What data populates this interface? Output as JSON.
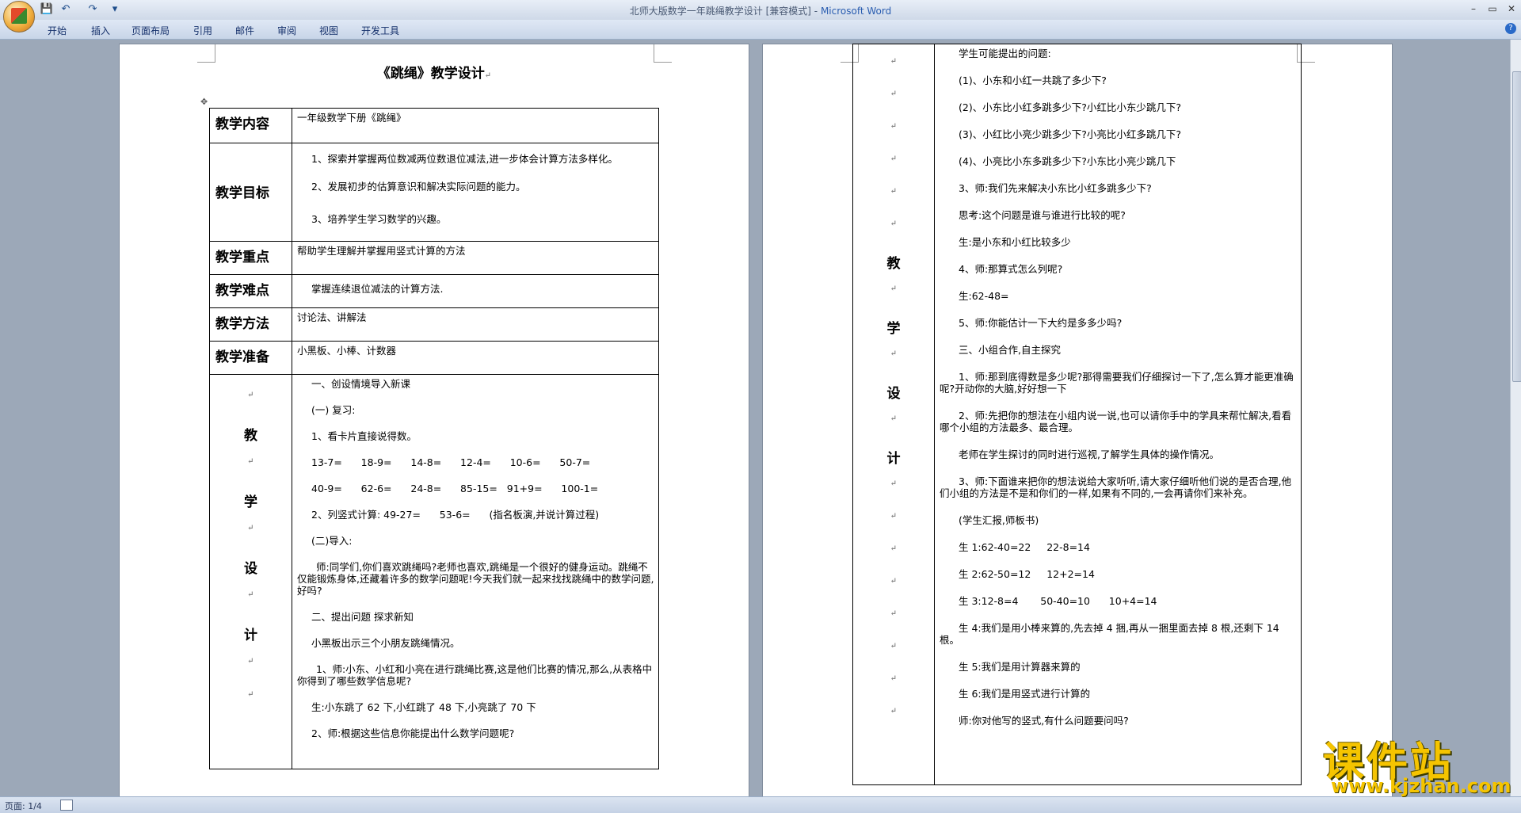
{
  "window": {
    "doc_title": "北师大版数学一年跳绳教学设计 [兼容模式]",
    "separator": " - ",
    "app_name": "Microsoft Word",
    "minimize": "–",
    "maximize": "▭",
    "close": "✕"
  },
  "quick_access": {
    "save": "💾",
    "undo": "↶",
    "redo": "↷",
    "customize": "▾"
  },
  "ribbon": {
    "tabs": [
      "开始",
      "插入",
      "页面布局",
      "引用",
      "邮件",
      "审阅",
      "视图",
      "开发工具"
    ],
    "help": "?"
  },
  "page1": {
    "title": "《跳绳》教学设计",
    "rows": [
      {
        "label": "教学内容",
        "content": [
          "一年级数学下册《跳绳》"
        ]
      },
      {
        "label": "教学目标",
        "content": [
          "1、探索并掌握两位数减两位数退位减法,进一步体会计算方法多样化。",
          "2、发展初步的估算意识和解决实际问题的能力。",
          "3、培养学生学习数学的兴趣。"
        ]
      },
      {
        "label": "教学重点",
        "content": [
          "帮助学生理解并掌握用竖式计算的方法"
        ]
      },
      {
        "label": "教学难点",
        "content": [
          "掌握连续退位减法的计算方法."
        ]
      },
      {
        "label": "教学方法",
        "content": [
          "讨论法、讲解法"
        ]
      },
      {
        "label": "教学准备",
        "content": [
          "小黑板、小棒、计数器"
        ]
      }
    ],
    "design_label": [
      "教",
      "学",
      "设",
      "计"
    ],
    "design_lines": [
      "一、创设情境导入新课",
      "(一) 复习:",
      "1、看卡片直接说得数。",
      "13-7=      18-9=      14-8=      12-4=      10-6=      50-7=",
      "40-9=      62-6=      24-8=      85-15=   91+9=      100-1=",
      "2、列竖式计算: 49-27=      53-6=      (指名板演,并说计算过程)",
      "(二)导入:",
      "师:同学们,你们喜欢跳绳吗?老师也喜欢,跳绳是一个很好的健身运动。跳绳不仅能锻炼身体,还藏着许多的数学问题呢!今天我们就一起来找找跳绳中的数学问题,好吗?",
      "二、提出问题   探求新知",
      "小黑板出示三个小朋友跳绳情况。",
      "1、师:小东、小红和小亮在进行跳绳比赛,这是他们比赛的情况,那么,从表格中你得到了哪些数学信息呢?",
      "生:小东跳了 62 下,小红跳了 48 下,小亮跳了 70 下",
      "2、师:根据这些信息你能提出什么数学问题呢?"
    ]
  },
  "page2": {
    "design_label": [
      "教",
      "学",
      "设",
      "计"
    ],
    "lines": [
      "学生可能提出的问题:",
      "(1)、小东和小红一共跳了多少下?",
      "(2)、小东比小红多跳多少下?小红比小东少跳几下?",
      "(3)、小红比小亮少跳多少下?小亮比小红多跳几下?",
      "(4)、小亮比小东多跳多少下?小东比小亮少跳几下",
      "3、师:我们先来解决小东比小红多跳多少下?",
      "思考:这个问题是谁与谁进行比较的呢?",
      "生:是小东和小红比较多少",
      "4、师:那算式怎么列呢?",
      "生:62-48=",
      "5、师:你能估计一下大约是多多少吗?",
      "三、小组合作,自主探究",
      "1、师:那到底得数是多少呢?那得需要我们仔细探讨一下了,怎么算才能更准确呢?开动你的大脑,好好想一下",
      "2、师:先把你的想法在小组内说一说,也可以请你手中的学具来帮忙解决,看看哪个小组的方法最多、最合理。",
      "老师在学生探讨的同时进行巡视,了解学生具体的操作情况。",
      "3、师:下面谁来把你的想法说给大家听听,请大家仔细听他们说的是否合理,他们小组的方法是不是和你们的一样,如果有不同的,一会再请你们来补充。",
      "(学生汇报,师板书)",
      "生 1:62-40=22     22-8=14",
      "生 2:62-50=12     12+2=14",
      "生 3:12-8=4       50-40=10      10+4=14",
      "生 4:我们是用小棒来算的,先去掉 4 捆,再从一捆里面去掉 8 根,还剩下 14 根。",
      "生 5:我们是用计算器来算的",
      "生 6:我们是用竖式进行计算的",
      "师:你对他写的竖式,有什么问题要问吗?"
    ]
  },
  "status": {
    "page": "页面: 1/4"
  },
  "watermark": {
    "title": "课件站",
    "url": "www.kjzhan.com"
  },
  "marks": {
    "para": "↵",
    "anchor": "✥"
  }
}
